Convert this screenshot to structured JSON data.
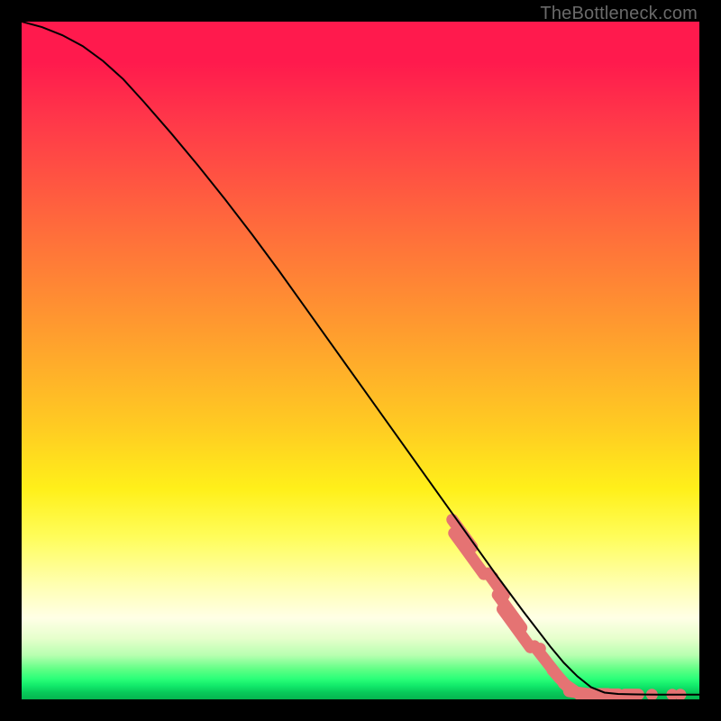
{
  "watermark": "TheBottleneck.com",
  "chart_data": {
    "type": "line",
    "title": "",
    "xlabel": "",
    "ylabel": "",
    "xlim": [
      0,
      100
    ],
    "ylim": [
      0,
      100
    ],
    "grid": false,
    "series": [
      {
        "name": "curve",
        "style": "line",
        "color": "#000000",
        "x": [
          0,
          3,
          6,
          9,
          12,
          15,
          18,
          22,
          26,
          30,
          34,
          38,
          42,
          46,
          50,
          54,
          58,
          62,
          66,
          70,
          74,
          78,
          80,
          82,
          84,
          86,
          88,
          90,
          92,
          94,
          96,
          98,
          100
        ],
        "y": [
          100,
          99.2,
          98.0,
          96.4,
          94.2,
          91.5,
          88.2,
          83.6,
          78.8,
          73.8,
          68.6,
          63.2,
          57.6,
          52.0,
          46.4,
          40.8,
          35.2,
          29.6,
          24.0,
          18.4,
          13.0,
          7.8,
          5.4,
          3.4,
          1.8,
          1.0,
          0.8,
          0.75,
          0.72,
          0.7,
          0.7,
          0.7,
          0.7
        ]
      },
      {
        "name": "segment-markers",
        "style": "markers",
        "color": "#e57373",
        "points": [
          {
            "x": 65.0,
            "y": 24.5,
            "type": "pill",
            "len": 5.0,
            "angle": -54
          },
          {
            "x": 66.0,
            "y": 21.5,
            "type": "pill",
            "len": 7.5,
            "angle": -54
          },
          {
            "x": 69.5,
            "y": 18.0,
            "type": "dot"
          },
          {
            "x": 70.0,
            "y": 17.0,
            "type": "pill",
            "len": 4.0,
            "angle": -54
          },
          {
            "x": 72.0,
            "y": 13.0,
            "type": "pill",
            "len": 6.0,
            "angle": -54
          },
          {
            "x": 73.0,
            "y": 10.5,
            "type": "pill",
            "len": 7.0,
            "angle": -54
          },
          {
            "x": 76.5,
            "y": 7.5,
            "type": "dot"
          },
          {
            "x": 77.5,
            "y": 5.5,
            "type": "pill",
            "len": 6.0,
            "angle": -52
          },
          {
            "x": 79.5,
            "y": 3.0,
            "type": "pill",
            "len": 3.5,
            "angle": -48
          },
          {
            "x": 81.2,
            "y": 1.5,
            "type": "pill",
            "len": 3.0,
            "angle": -35
          },
          {
            "x": 82.5,
            "y": 0.95,
            "type": "pill",
            "len": 3.5,
            "angle": -8
          },
          {
            "x": 85.0,
            "y": 0.8,
            "type": "pill",
            "len": 3.0,
            "angle": 0
          },
          {
            "x": 86.8,
            "y": 0.75,
            "type": "pill",
            "len": 2.5,
            "angle": 0
          },
          {
            "x": 88.0,
            "y": 0.75,
            "type": "dot"
          },
          {
            "x": 90.0,
            "y": 0.72,
            "type": "pill",
            "len": 2.0,
            "angle": 0
          },
          {
            "x": 93.0,
            "y": 0.7,
            "type": "dot"
          },
          {
            "x": 96.0,
            "y": 0.7,
            "type": "dot"
          },
          {
            "x": 97.2,
            "y": 0.7,
            "type": "dot"
          }
        ]
      }
    ]
  }
}
